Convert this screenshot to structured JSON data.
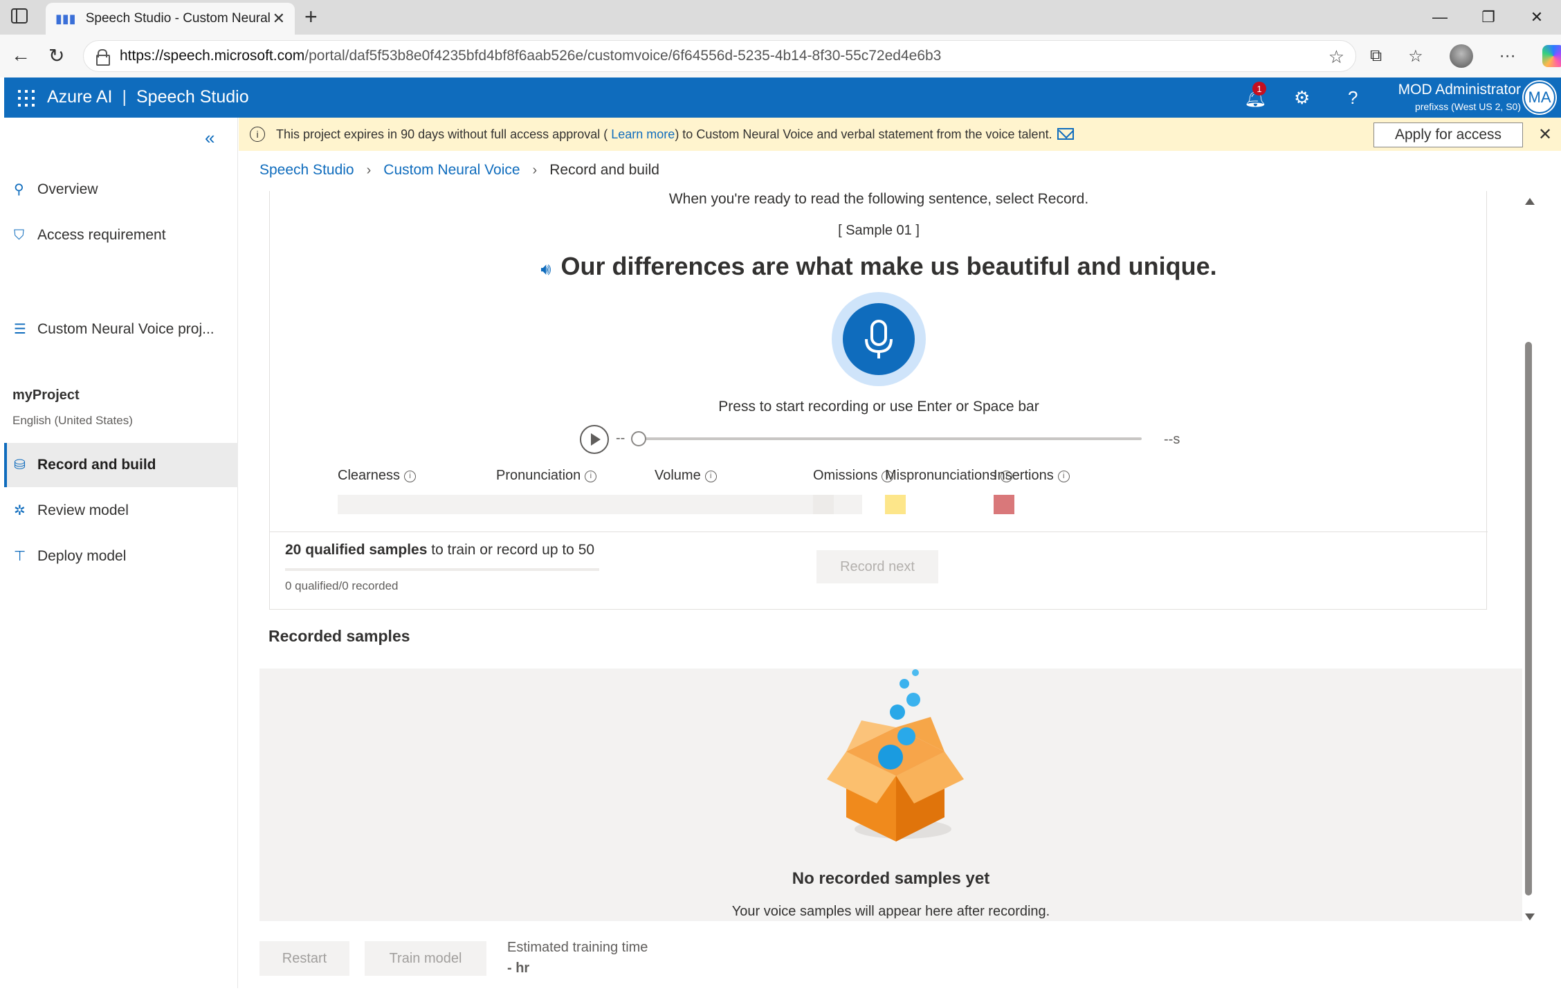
{
  "browser": {
    "tab_title": "Speech Studio - Custom Neural V",
    "url_host": "https://speech.microsoft.com",
    "url_path": "/portal/daf5f53b8e0f4235bfd4bf8f6aab526e/customvoice/6f64556d-5235-4b14-8f30-55c72ed4e6b3"
  },
  "header": {
    "brand": "Azure AI",
    "separator": "|",
    "product": "Speech Studio",
    "notification_count": "1",
    "user_name": "MOD Administrator",
    "user_sub": "prefixss (West US 2, S0)",
    "avatar_initials": "MA",
    "accent_color": "#0f6cbd"
  },
  "sidebar": {
    "items_top": [
      {
        "label": "Overview",
        "icon": "rocket-icon"
      },
      {
        "label": "Access requirement",
        "icon": "shield-icon"
      },
      {
        "label": "Custom Neural Voice proj...",
        "icon": "list-icon"
      }
    ],
    "project": {
      "name": "myProject",
      "language": "English (United States)"
    },
    "items_project": [
      {
        "label": "Record and build",
        "icon": "database-icon",
        "active": true
      },
      {
        "label": "Review model",
        "icon": "model-icon"
      },
      {
        "label": "Deploy model",
        "icon": "deploy-icon"
      }
    ]
  },
  "banner": {
    "text_before": "This project expires in 90 days without full access approval (",
    "link": "Learn more",
    "text_after": ") to Custom Neural Voice and verbal statement from the voice talent.",
    "apply_label": "Apply for access"
  },
  "breadcrumb": {
    "items": [
      "Speech Studio",
      "Custom Neural Voice"
    ],
    "current": "Record and build"
  },
  "recorder": {
    "instruction": "When you're ready to read the following sentence, select Record.",
    "sample_id": "[ Sample 01 ]",
    "sentence": "Our differences are what make us beautiful and unique.",
    "press_hint": "Press to start recording or use Enter or Space bar",
    "time_start": "--",
    "time_end": "--s",
    "metrics": [
      "Clearness",
      "Pronunciation",
      "Volume",
      "Omissions",
      "Mispronunciations",
      "Insertions"
    ],
    "swatch_colors": {
      "omissions": "#edebe9",
      "mispronunciations": "#fde68a",
      "insertions": "#d9787a"
    }
  },
  "progress": {
    "qualified_bold": "20 qualified samples",
    "qualified_rest": " to train or record up to 50",
    "status": "0 qualified/0 recorded",
    "record_next": "Record next"
  },
  "recorded": {
    "title": "Recorded samples",
    "empty_title": "No recorded samples yet",
    "empty_sub": "Your voice samples will appear here after recording."
  },
  "footer": {
    "restart": "Restart",
    "train": "Train model",
    "est_label": "Estimated training time",
    "est_value": "- hr"
  }
}
